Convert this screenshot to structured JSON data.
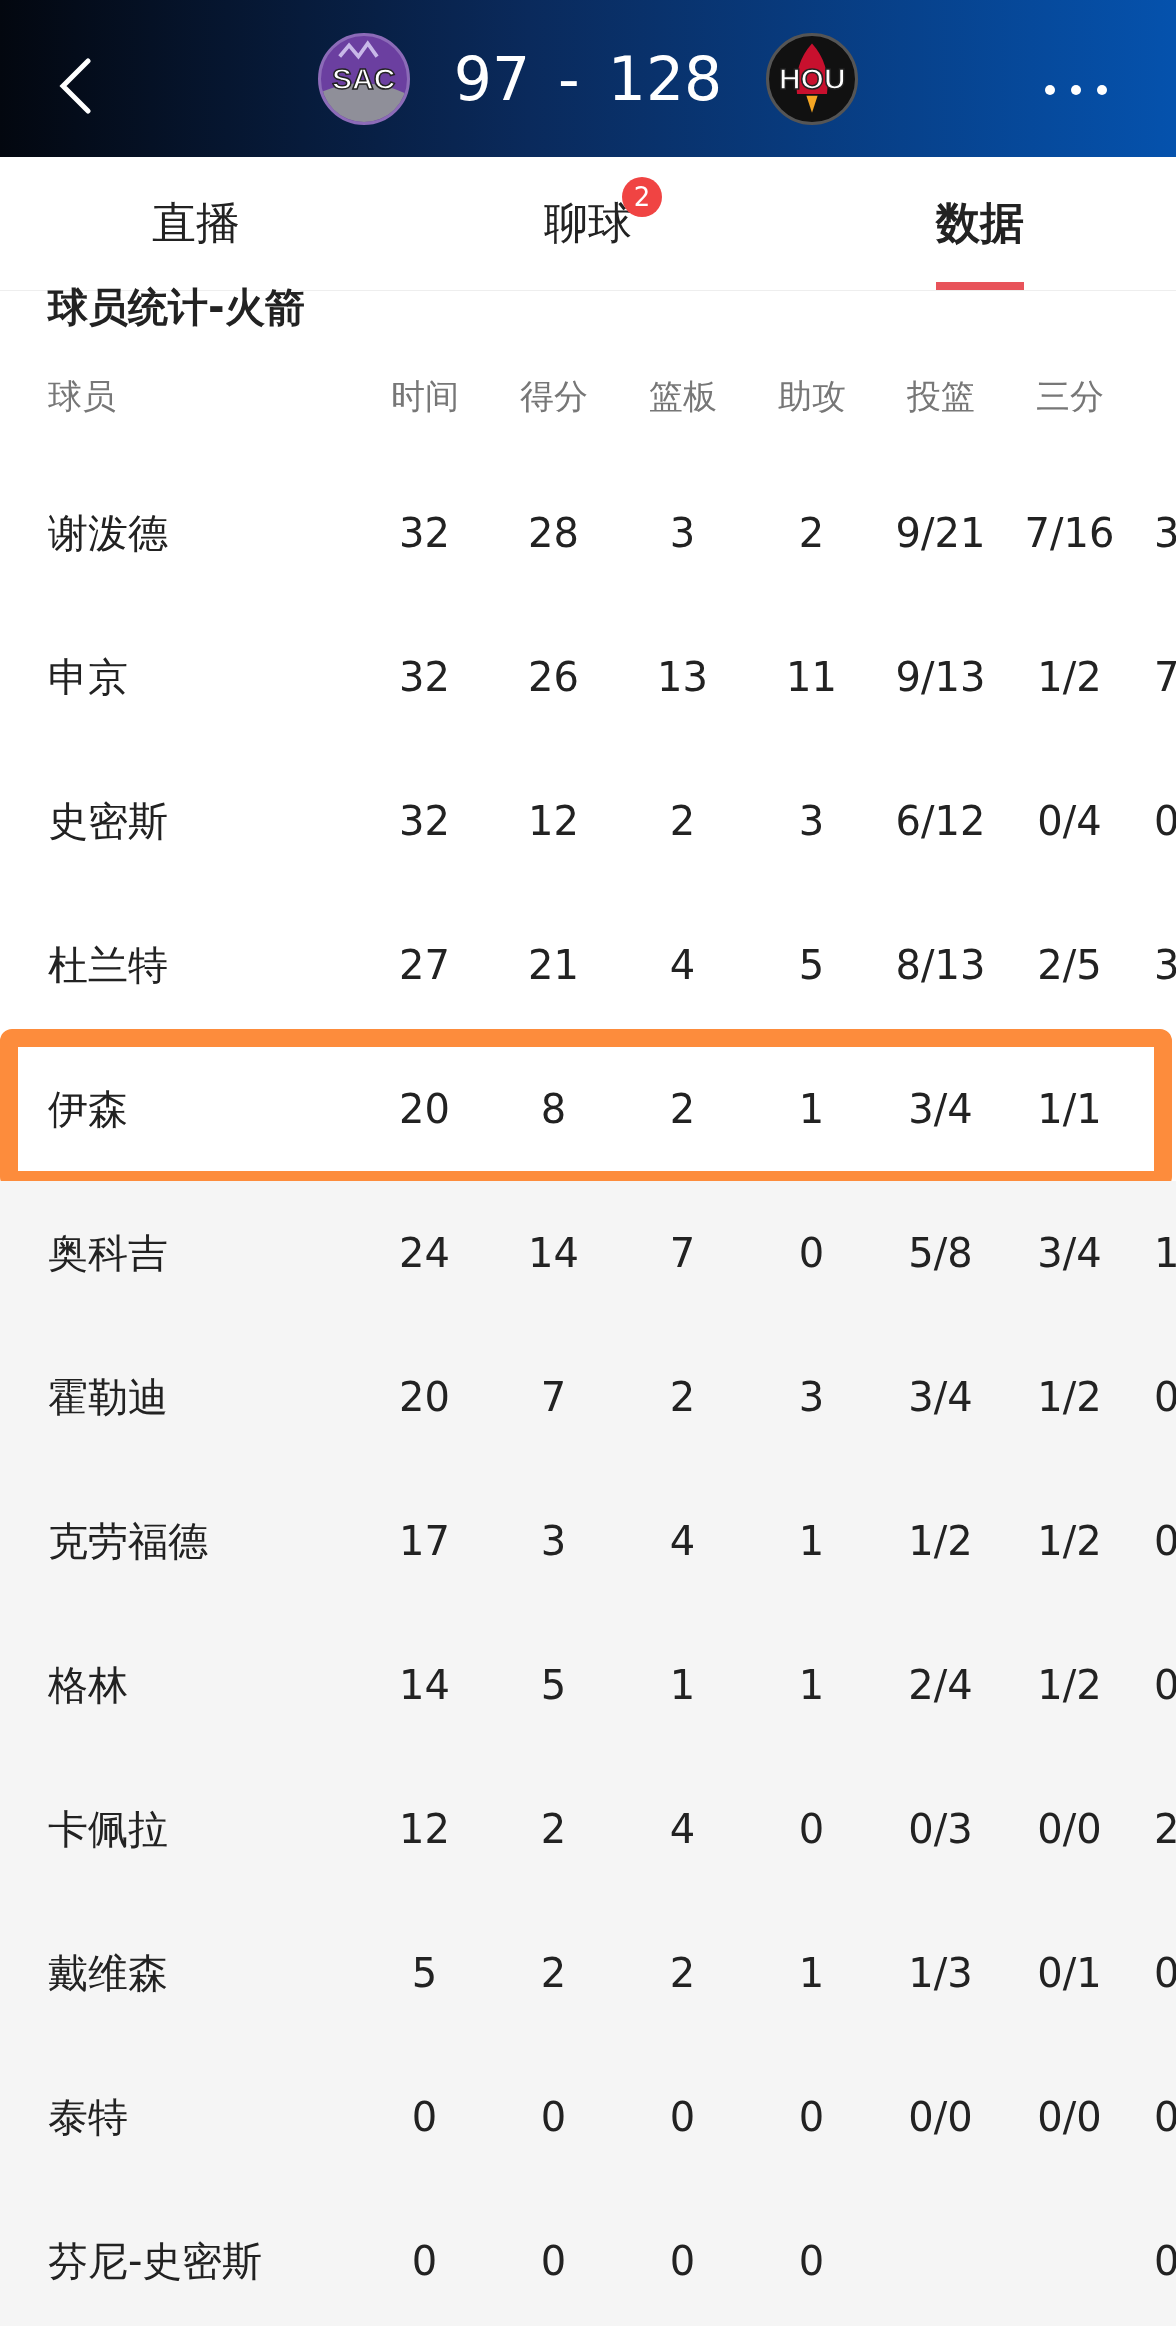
{
  "header": {
    "home": {
      "abbr": "SAC"
    },
    "score": {
      "home": "97",
      "separator": "-",
      "away": "128"
    },
    "away": {
      "abbr": "HOU"
    }
  },
  "tabs": [
    {
      "label": "直播",
      "selected": false
    },
    {
      "label": "聊球",
      "selected": false,
      "badge": "2"
    },
    {
      "label": "数据",
      "selected": true
    }
  ],
  "section_title": "球员统计-火箭",
  "table": {
    "columns": [
      "球员",
      "时间",
      "得分",
      "篮板",
      "助攻",
      "投篮",
      "三分"
    ],
    "rows": [
      {
        "cells": [
          "谢泼德",
          "32",
          "28",
          "3",
          "2",
          "9/21",
          "7/16",
          "3"
        ],
        "highlighted": false
      },
      {
        "cells": [
          "申京",
          "32",
          "26",
          "13",
          "11",
          "9/13",
          "1/2",
          "7"
        ],
        "highlighted": false
      },
      {
        "cells": [
          "史密斯",
          "32",
          "12",
          "2",
          "3",
          "6/12",
          "0/4",
          "0"
        ],
        "highlighted": false
      },
      {
        "cells": [
          "杜兰特",
          "27",
          "21",
          "4",
          "5",
          "8/13",
          "2/5",
          "3"
        ],
        "highlighted": false
      },
      {
        "cells": [
          "伊森",
          "20",
          "8",
          "2",
          "1",
          "3/4",
          "1/1"
        ],
        "highlighted": true
      },
      {
        "cells": [
          "奥科吉",
          "24",
          "14",
          "7",
          "0",
          "5/8",
          "3/4",
          "1"
        ],
        "highlighted": false
      },
      {
        "cells": [
          "霍勒迪",
          "20",
          "7",
          "2",
          "3",
          "3/4",
          "1/2",
          "0"
        ],
        "highlighted": false
      },
      {
        "cells": [
          "克劳福德",
          "17",
          "3",
          "4",
          "1",
          "1/2",
          "1/2",
          "0"
        ],
        "highlighted": false
      },
      {
        "cells": [
          "格林",
          "14",
          "5",
          "1",
          "1",
          "2/4",
          "1/2",
          "0"
        ],
        "highlighted": false
      },
      {
        "cells": [
          "卡佩拉",
          "12",
          "2",
          "4",
          "0",
          "0/3",
          "0/0",
          "2"
        ],
        "highlighted": false
      },
      {
        "cells": [
          "戴维森",
          "5",
          "2",
          "2",
          "1",
          "1/3",
          "0/1",
          "0"
        ],
        "highlighted": false
      },
      {
        "cells": [
          "泰特",
          "0",
          "0",
          "0",
          "0",
          "0/0",
          "0/0",
          "0"
        ],
        "highlighted": false
      },
      {
        "cells": [
          "芬尼-史密斯",
          "0",
          "0",
          "0",
          "0",
          null,
          null,
          "0"
        ],
        "highlighted": false
      }
    ]
  }
}
